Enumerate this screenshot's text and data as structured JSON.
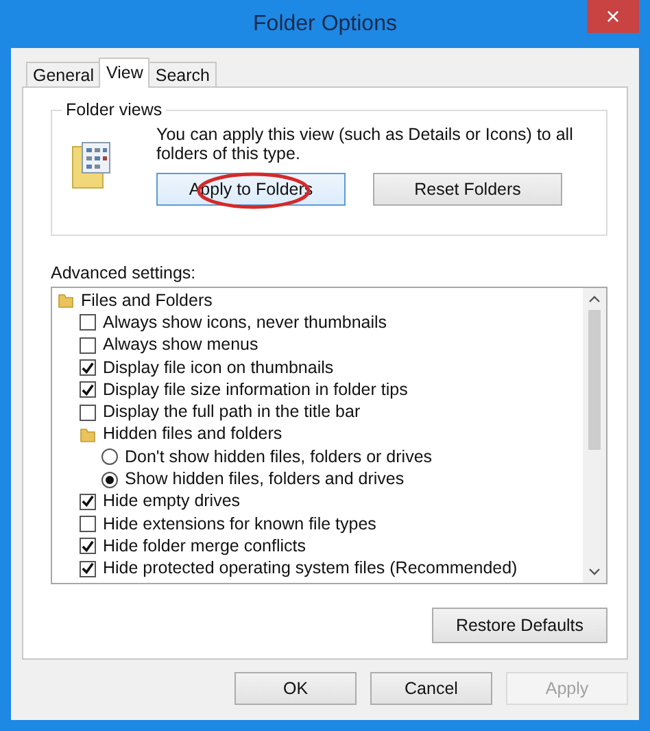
{
  "window": {
    "title": "Folder Options",
    "close": "×"
  },
  "tabs": [
    {
      "label": "General",
      "selected": false
    },
    {
      "label": "View",
      "selected": true
    },
    {
      "label": "Search",
      "selected": false
    }
  ],
  "folder_views": {
    "legend": "Folder views",
    "text": "You can apply this view (such as Details or Icons) to all folders of this type.",
    "buttons": [
      {
        "label": "Apply to Folders",
        "circled": true
      },
      {
        "label": "Reset Folders",
        "circled": false
      }
    ]
  },
  "advanced": {
    "label": "Advanced settings:",
    "items": [
      {
        "kind": "folder",
        "label": "Files and Folders",
        "children": [
          {
            "kind": "checkbox",
            "label": "Always show icons, never thumbnails",
            "checked": false
          },
          {
            "kind": "checkbox",
            "label": "Always show menus",
            "checked": false
          },
          {
            "kind": "checkbox",
            "label": "Display file icon on thumbnails",
            "checked": true
          },
          {
            "kind": "checkbox",
            "label": "Display file size information in folder tips",
            "checked": true
          },
          {
            "kind": "checkbox",
            "label": "Display the full path in the title bar",
            "checked": false
          },
          {
            "kind": "folder",
            "label": "Hidden files and folders",
            "children": [
              {
                "kind": "radio",
                "label": "Don't show hidden files, folders or drives",
                "selected": false
              },
              {
                "kind": "radio",
                "label": "Show hidden files, folders and drives",
                "selected": true
              }
            ]
          },
          {
            "kind": "checkbox",
            "label": "Hide empty drives",
            "checked": true
          },
          {
            "kind": "checkbox",
            "label": "Hide extensions for known file types",
            "checked": false
          },
          {
            "kind": "checkbox",
            "label": "Hide folder merge conflicts",
            "checked": true
          },
          {
            "kind": "checkbox",
            "label": "Hide protected operating system files (Recommended)",
            "checked": true
          }
        ]
      }
    ]
  },
  "restore_button": "Restore Defaults",
  "buttons": [
    {
      "label": "OK",
      "disabled": false
    },
    {
      "label": "Cancel",
      "disabled": false
    },
    {
      "label": "Apply",
      "disabled": true
    }
  ]
}
